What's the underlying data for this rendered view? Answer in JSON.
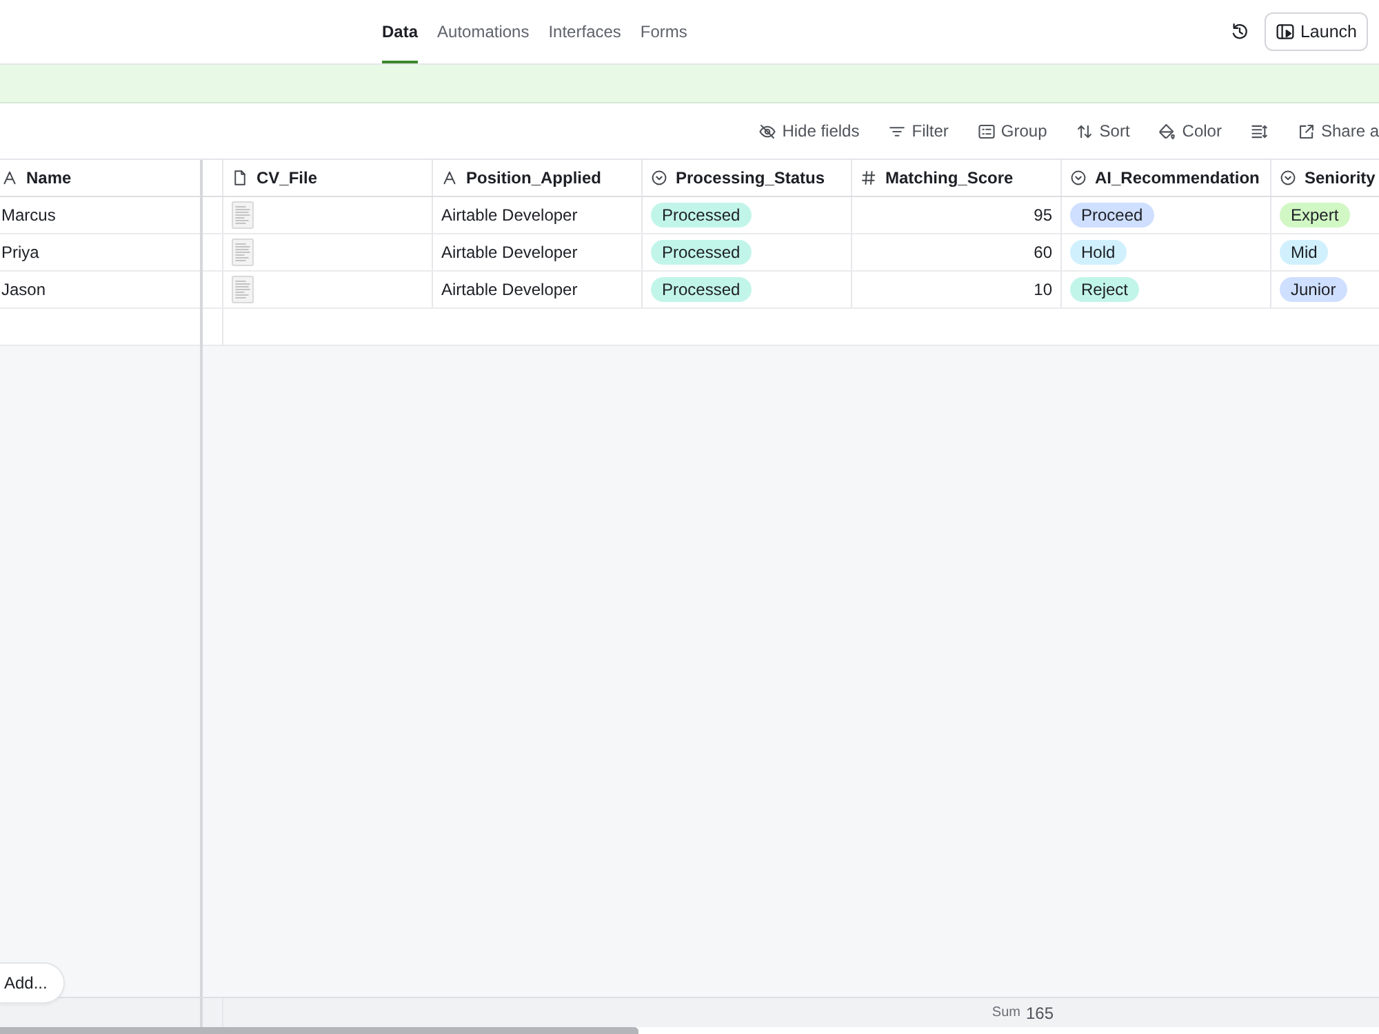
{
  "nav": {
    "tabs": [
      {
        "label": "Data",
        "selected": true
      },
      {
        "label": "Automations",
        "selected": false
      },
      {
        "label": "Interfaces",
        "selected": false
      },
      {
        "label": "Forms",
        "selected": false
      }
    ],
    "launch_button": "Launch"
  },
  "toolbar": [
    {
      "kind": "hide_fields",
      "label": "Hide fields"
    },
    {
      "kind": "filter",
      "label": "Filter"
    },
    {
      "kind": "group",
      "label": "Group"
    },
    {
      "kind": "sort",
      "label": "Sort"
    },
    {
      "kind": "color",
      "label": "Color"
    },
    {
      "kind": "row_height"
    },
    {
      "kind": "share",
      "label": "Share a"
    }
  ],
  "table": {
    "columns": [
      {
        "title": "Name",
        "kind": "text"
      },
      {
        "title": "CV_File",
        "kind": "attachment"
      },
      {
        "title": "Position_Applied",
        "kind": "text"
      },
      {
        "title": "Processing_Status",
        "kind": "select"
      },
      {
        "title": "Matching_Score",
        "kind": "number",
        "summary": {
          "label": "Sum",
          "value": "165"
        }
      },
      {
        "title": "AI_Recommendation",
        "kind": "select"
      },
      {
        "title": "Seniority",
        "kind": "select"
      }
    ],
    "rows": [
      {
        "cells": [
          {
            "text": "Marcus"
          },
          {
            "has_file": true
          },
          {
            "text": "Airtable Developer"
          },
          {
            "text": "Processed",
            "color": "#c2f5e9"
          },
          {
            "text": "95"
          },
          {
            "text": "Proceed",
            "color": "#cfdfff"
          },
          {
            "text": "Expert",
            "color": "#d1f7c4"
          }
        ]
      },
      {
        "cells": [
          {
            "text": "Priya"
          },
          {
            "has_file": true
          },
          {
            "text": "Airtable Developer"
          },
          {
            "text": "Processed",
            "color": "#c2f5e9"
          },
          {
            "text": "60"
          },
          {
            "text": "Hold",
            "color": "#d0f0fd"
          },
          {
            "text": "Mid",
            "color": "#d0f0fd"
          }
        ]
      },
      {
        "cells": [
          {
            "text": "Jason"
          },
          {
            "has_file": true
          },
          {
            "text": "Airtable Developer"
          },
          {
            "text": "Processed",
            "color": "#c2f5e9"
          },
          {
            "text": "10"
          },
          {
            "text": "Reject",
            "color": "#c2f5e9"
          },
          {
            "text": "Junior",
            "color": "#cfdfff"
          }
        ]
      }
    ]
  },
  "add_button": "Add..."
}
